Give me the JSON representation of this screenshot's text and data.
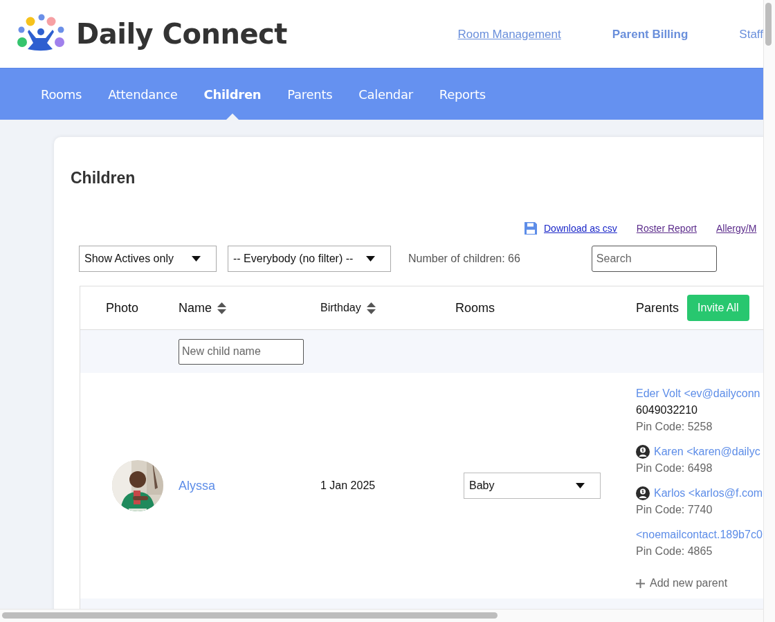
{
  "brand": {
    "name": "Daily Connect"
  },
  "top_links": [
    {
      "label": "Room Management",
      "kind": "underlined"
    },
    {
      "label": "Parent Billing",
      "kind": "bold"
    },
    {
      "label": "Staff",
      "kind": "plain"
    }
  ],
  "nav": [
    {
      "label": "Rooms",
      "selected": false
    },
    {
      "label": "Attendance",
      "selected": false
    },
    {
      "label": "Children",
      "selected": true
    },
    {
      "label": "Parents",
      "selected": false
    },
    {
      "label": "Calendar",
      "selected": false
    },
    {
      "label": "Reports",
      "selected": false
    }
  ],
  "page": {
    "title": "Children",
    "actions": [
      {
        "label": "Download as csv",
        "kind": "download"
      },
      {
        "label": "Roster Report",
        "kind": "visited"
      },
      {
        "label": "Allergy/M",
        "kind": "visited"
      }
    ],
    "filters": {
      "status": "Show Actives only",
      "group": "-- Everybody (no filter) --",
      "count": "Number of children: 66",
      "search_placeholder": "Search"
    }
  },
  "table": {
    "columns": [
      {
        "label": "Photo",
        "sortable": false
      },
      {
        "label": "Name",
        "sortable": true
      },
      {
        "label": "Birthday",
        "sortable": true
      },
      {
        "label": "Rooms",
        "sortable": false
      },
      {
        "label": "Parents",
        "sortable": false
      }
    ],
    "invite_button": "Invite All",
    "new_child_placeholder": "New child name",
    "rows": [
      {
        "photo": {
          "kind": "picture"
        },
        "name": "Alyssa",
        "birthday": "1 Jan 2025",
        "room": "Baby",
        "parents": [
          {
            "contact": "Eder Volt <ev@dailyconn",
            "phone": "6049032210",
            "pin": "Pin Code: 5258",
            "billing": false
          },
          {
            "contact": "Karen <karen@dailyc",
            "pin": "Pin Code: 6498",
            "billing": true
          },
          {
            "contact": "Karlos <karlos@f.com",
            "pin": "Pin Code: 7740",
            "billing": true
          },
          {
            "contact": "<noemailcontact.189b7c0",
            "pin": "Pin Code: 4865",
            "billing": false
          }
        ],
        "add_parent": "Add new parent"
      }
    ]
  }
}
